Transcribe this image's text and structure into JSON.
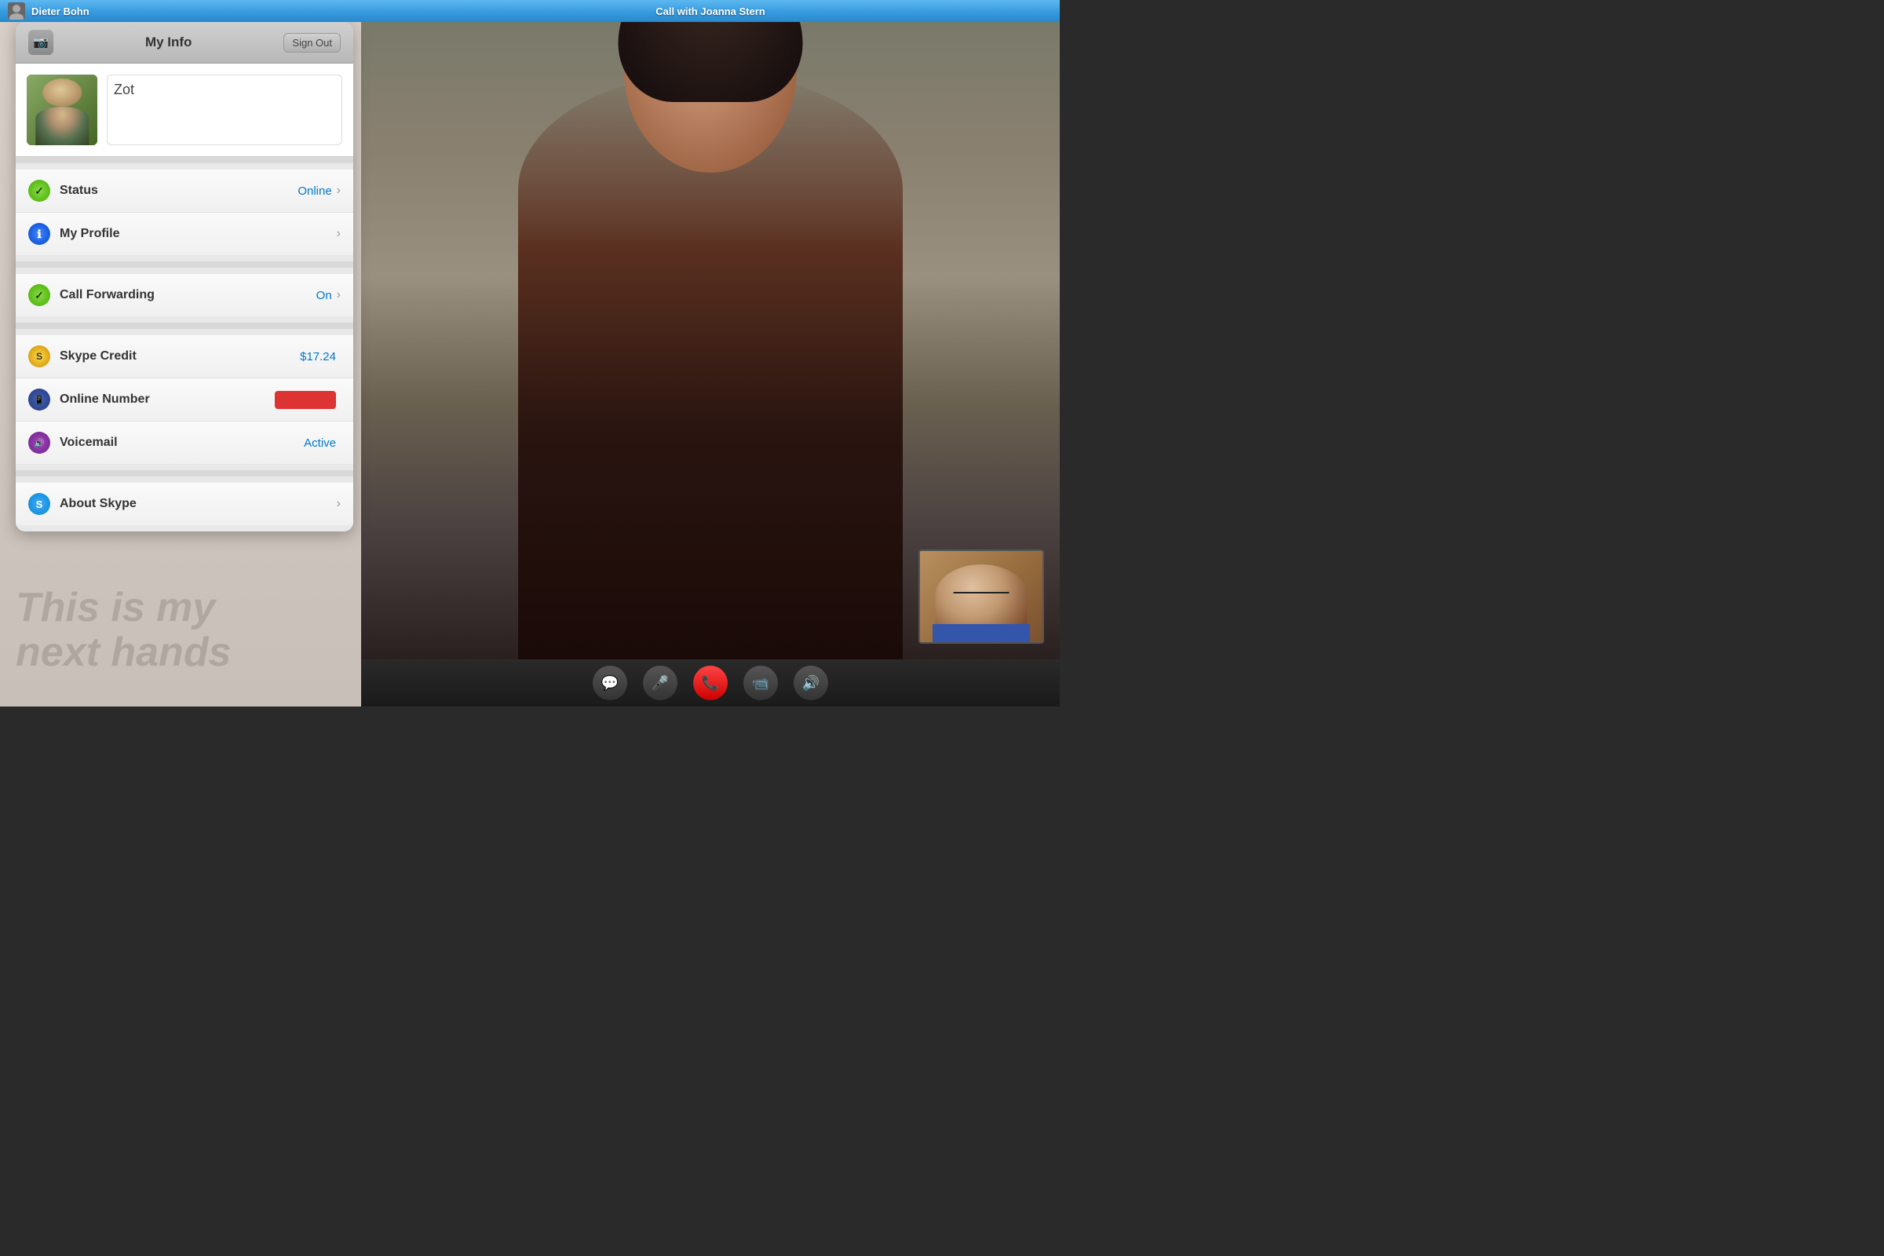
{
  "topBar": {
    "leftName": "Dieter Bohn",
    "rightName": "Call with Joanna Stern"
  },
  "panel": {
    "title": "My Info",
    "signOutLabel": "Sign Out",
    "cameraIcon": "📷",
    "profile": {
      "name": "Zot"
    },
    "menuGroups": [
      {
        "items": [
          {
            "id": "status",
            "iconClass": "icon-green",
            "iconSymbol": "✓",
            "label": "Status",
            "value": "Online",
            "valueType": "blue",
            "hasChevron": true
          },
          {
            "id": "my-profile",
            "iconClass": "icon-blue",
            "iconSymbol": "ℹ",
            "label": "My Profile",
            "value": "",
            "valueType": "none",
            "hasChevron": true
          }
        ]
      },
      {
        "items": [
          {
            "id": "call-forwarding",
            "iconClass": "icon-green",
            "iconSymbol": "✓",
            "label": "Call Forwarding",
            "value": "On",
            "valueType": "blue",
            "hasChevron": true
          }
        ]
      },
      {
        "items": [
          {
            "id": "skype-credit",
            "iconClass": "icon-yellow",
            "iconSymbol": "S",
            "label": "Skype Credit",
            "value": "$17.24",
            "valueType": "blue",
            "hasChevron": false
          },
          {
            "id": "online-number",
            "iconClass": "icon-darkblue",
            "iconSymbol": "📱",
            "label": "Online Number",
            "value": "RED_BAR",
            "valueType": "red",
            "hasChevron": false
          },
          {
            "id": "voicemail",
            "iconClass": "icon-purple",
            "iconSymbol": "🔊",
            "label": "Voicemail",
            "value": "Active",
            "valueType": "plain",
            "hasChevron": false
          }
        ]
      },
      {
        "items": [
          {
            "id": "about-skype",
            "iconClass": "icon-skypeblue",
            "iconSymbol": "S",
            "label": "About Skype",
            "value": "",
            "valueType": "none",
            "hasChevron": true
          }
        ]
      }
    ]
  },
  "callBar": {
    "buttons": [
      {
        "id": "chat",
        "icon": "💬",
        "type": "gray"
      },
      {
        "id": "mute",
        "icon": "🎤",
        "type": "gray"
      },
      {
        "id": "end-call",
        "icon": "📞",
        "type": "red"
      },
      {
        "id": "video",
        "icon": "📹",
        "type": "gray"
      },
      {
        "id": "speaker",
        "icon": "🔊",
        "type": "gray"
      }
    ]
  },
  "watermark": {
    "line1": "This is my",
    "line2": "next hands"
  }
}
